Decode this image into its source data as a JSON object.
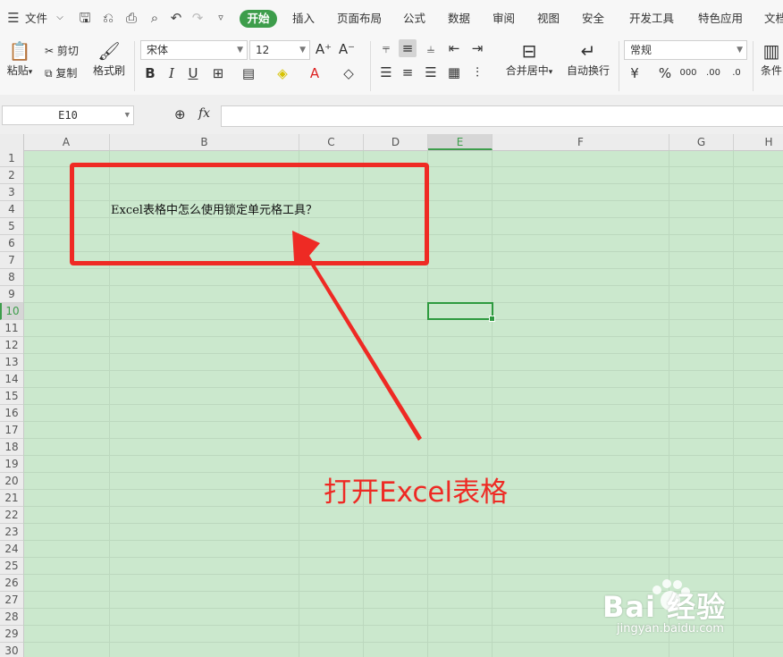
{
  "menubar": {
    "file_label": "文件",
    "tabs": [
      "开始",
      "插入",
      "页面布局",
      "公式",
      "数据",
      "审阅",
      "视图",
      "安全",
      "开发工具",
      "特色应用",
      "文档"
    ]
  },
  "ribbon": {
    "paste_label": "粘贴",
    "cut_label": "剪切",
    "copy_label": "复制",
    "format_painter_label": "格式刷",
    "font_name": "宋体",
    "font_size": "12",
    "bold": "B",
    "italic": "I",
    "underline": "U",
    "merge_center_label": "合并居中",
    "wrap_text_label": "自动换行",
    "number_format": "常规",
    "percent": "%",
    "conditional_label": "条件"
  },
  "formula_bar": {
    "name_box": "E10",
    "fx_label": "fx",
    "content": ""
  },
  "sheet": {
    "columns": [
      "A",
      "B",
      "C",
      "D",
      "E",
      "F",
      "G",
      "H"
    ],
    "selected_column": "E",
    "rows": [
      "1",
      "2",
      "3",
      "4",
      "5",
      "6",
      "7",
      "8",
      "9",
      "10",
      "11",
      "12",
      "13",
      "14",
      "15",
      "16",
      "17",
      "18",
      "19",
      "20",
      "21",
      "22",
      "23",
      "24",
      "25",
      "26",
      "27",
      "28",
      "29",
      "30"
    ],
    "selected_row": "10",
    "active_cell": "E10",
    "b4_value": "Excel表格中怎么使用锁定单元格工具？"
  },
  "annotation": {
    "caption": "打开Excel表格",
    "color": "#ee2a24"
  },
  "watermark": {
    "brand": "Bai 经验",
    "url": "jingyan.baidu.com"
  },
  "colors": {
    "accent_green": "#3d9d4b",
    "sheet_background": "#cbe8cd"
  }
}
